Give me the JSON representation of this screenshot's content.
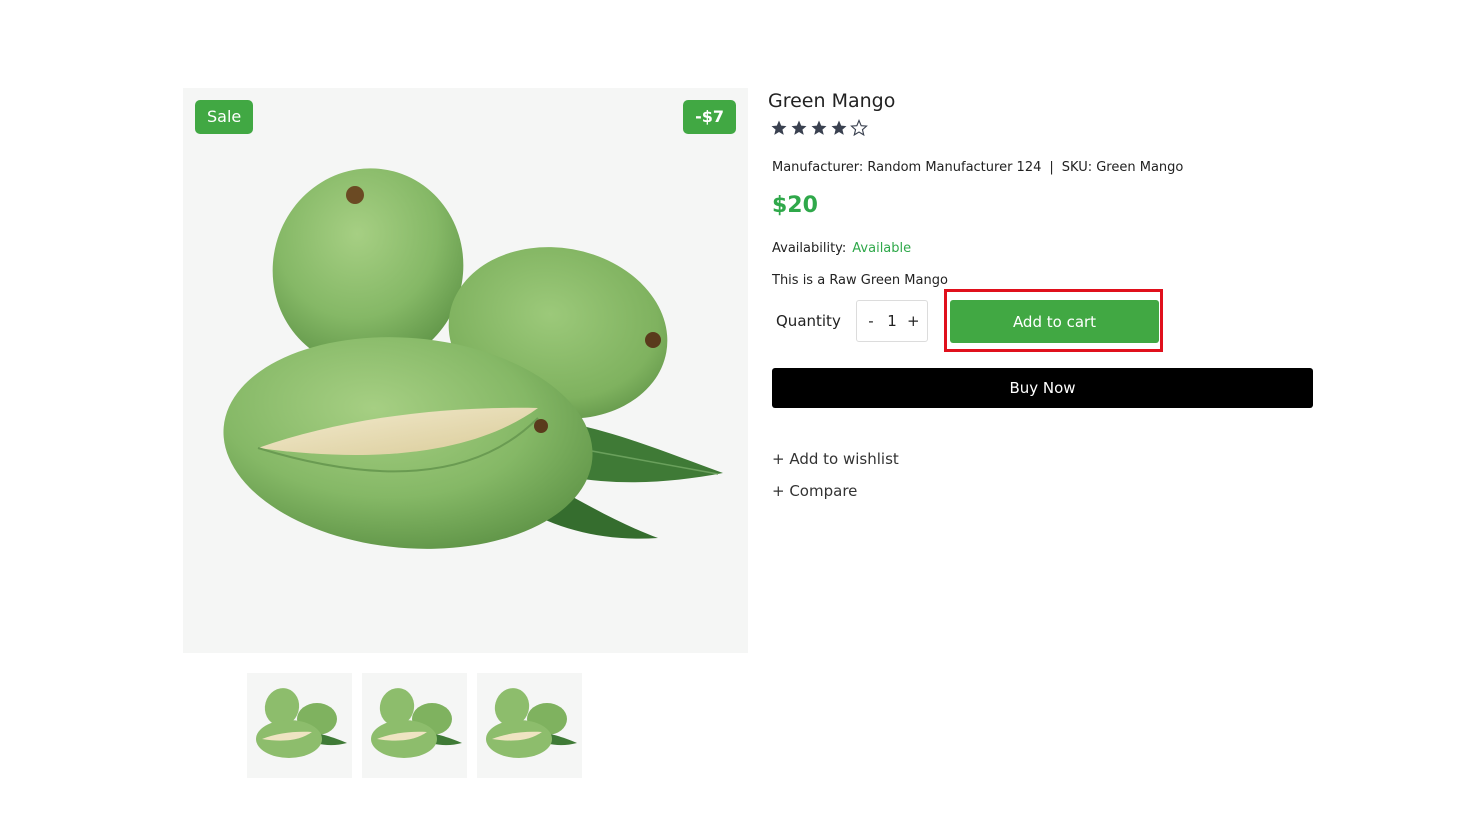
{
  "product": {
    "title": "Green Mango",
    "rating": 4,
    "rating_max": 5,
    "manufacturer_label": "Manufacturer: Random Manufacturer 124",
    "separator": "|",
    "sku_label": "SKU: Green Mango",
    "price": "$20",
    "availability_label": "Availability:",
    "availability_value": "Available",
    "description": "This is a Raw Green Mango"
  },
  "badges": {
    "sale": "Sale",
    "discount": "-$7"
  },
  "quantity": {
    "label": "Quantity",
    "decrement": "-",
    "value": "1",
    "increment": "+"
  },
  "actions": {
    "add_to_cart": "Add to cart",
    "buy_now": "Buy Now",
    "wishlist": "+ Add to wishlist",
    "compare": "+ Compare"
  },
  "colors": {
    "accent_green": "#41a843",
    "price_green": "#2fa84a",
    "highlight_red": "#e0101c",
    "buy_now_bg": "#000000",
    "star": "#3a4150"
  },
  "thumbnails": [
    {
      "icon": "mango-thumbnail"
    },
    {
      "icon": "mango-thumbnail"
    },
    {
      "icon": "mango-thumbnail"
    }
  ]
}
